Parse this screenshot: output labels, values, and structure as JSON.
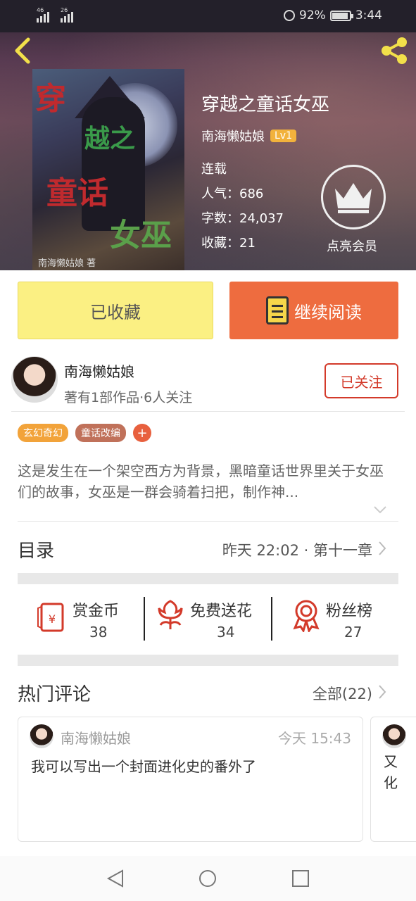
{
  "status_bar": {
    "signal1": "46",
    "signal2": "26",
    "battery": "92%",
    "battery_level": 0.92,
    "time": "3:44"
  },
  "book": {
    "title": "穿越之童话女巫",
    "author": "南海懒姑娘",
    "level": "Lv1",
    "status": "连载",
    "popularity": "人气：686",
    "word_count": "字数：24,037",
    "favorites": "收藏：21",
    "vip_label": "点亮会员",
    "cover_text": {
      "c1": "穿",
      "c2": "越之",
      "c3": "童话",
      "c4": "女巫",
      "author": "南海懒姑娘 著"
    }
  },
  "actions": {
    "favorited": "已收藏",
    "continue_reading": "继续阅读"
  },
  "author_block": {
    "name": "南海懒姑娘",
    "stats": "著有1部作品·6人关注",
    "follow": "已关注"
  },
  "tags": [
    {
      "label": "玄幻奇幻",
      "color": "#f2a33a"
    },
    {
      "label": "童话改编",
      "color": "#c0715a"
    }
  ],
  "tag_add": "+",
  "synopsis": "这是发生在一个架空西方为背景，黑暗童话世界里关于女巫们的故事，女巫是一群会骑着扫把，制作神...",
  "toc": {
    "label": "目录",
    "latest": "昨天 22:02 · 第十一章"
  },
  "stats": [
    {
      "label": "赏金币",
      "value": "38"
    },
    {
      "label": "免费送花",
      "value": "34"
    },
    {
      "label": "粉丝榜",
      "value": "27"
    }
  ],
  "comments": {
    "label": "热门评论",
    "all": "全部(22)",
    "items": [
      {
        "user": "南海懒姑娘",
        "time": "今天 15:43",
        "text": "我可以写出一个封面进化史的番外了"
      },
      {
        "user": "",
        "time": "",
        "text": "又化"
      }
    ]
  },
  "colors": {
    "favorite_bg": "#fbf083",
    "read_bg": "#ee6c3f",
    "follow_red": "#d33a2a",
    "level_badge": "#f2b23c"
  }
}
